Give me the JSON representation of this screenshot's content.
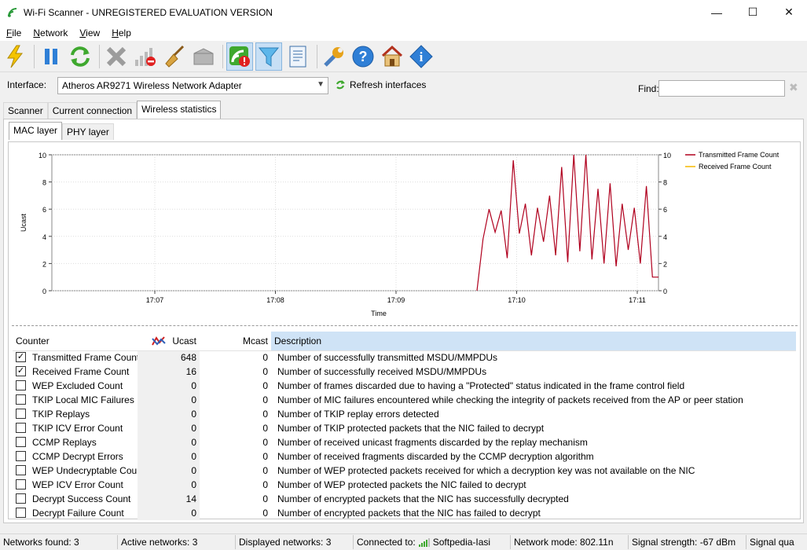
{
  "window": {
    "title": "Wi-Fi Scanner - UNREGISTERED EVALUATION VERSION",
    "minimize": "—",
    "maximize": "☐",
    "close": "✕"
  },
  "menu": [
    {
      "label": "File",
      "accel": "F",
      "rest": "ile"
    },
    {
      "label": "Network",
      "accel": "N",
      "rest": "etwork"
    },
    {
      "label": "View",
      "accel": "V",
      "rest": "iew"
    },
    {
      "label": "Help",
      "accel": "H",
      "rest": "elp"
    }
  ],
  "toolbar_icons": [
    "lightning-icon",
    "pause-icon",
    "refresh-icon",
    "delete-icon",
    "signal-remove-icon",
    "broom-icon",
    "box-icon",
    "wifi-warning-icon",
    "filter-icon",
    "notes-icon",
    "wrench-icon",
    "help-icon",
    "home-icon",
    "info-icon"
  ],
  "interface": {
    "label": "Interface:",
    "value": "Atheros AR9271 Wireless Network Adapter",
    "refresh_label": "Refresh interfaces",
    "find_label": "Find:",
    "find_value": ""
  },
  "tabs": {
    "scanner": "Scanner",
    "current": "Current connection",
    "wireless": "Wireless statistics",
    "mac": "MAC layer",
    "phy": "PHY layer"
  },
  "chart_data": {
    "type": "line",
    "xlabel": "Time",
    "ylabel": "Ucast",
    "ylim": [
      0,
      10
    ],
    "yticks": [
      "0",
      "2",
      "4",
      "6",
      "8",
      "10"
    ],
    "xticks": [
      "17:07",
      "17:08",
      "17:09",
      "17:10",
      "17:11"
    ],
    "grid": true,
    "legend_position": "top-right",
    "series": [
      {
        "name": "Transmitted Frame Count",
        "color": "#b0001e",
        "values": [
          0,
          3.8,
          6.0,
          4.3,
          5.9,
          2.4,
          9.6,
          4.2,
          6.4,
          2.6,
          6.1,
          3.6,
          7.0,
          2.6,
          9.1,
          2.1,
          10.0,
          2.9,
          10.0,
          2.3,
          7.5,
          2.0,
          7.9,
          1.8,
          6.4,
          3.0,
          6.1,
          2.0,
          7.7,
          1.0,
          1.0
        ]
      },
      {
        "name": "Received Frame Count",
        "color": "#f5b800",
        "values": []
      }
    ]
  },
  "table": {
    "headers": {
      "counter": "Counter",
      "ucast": "Ucast",
      "mcast": "Mcast",
      "desc": "Description"
    },
    "rows": [
      {
        "checked": true,
        "name": "Transmitted Frame Count",
        "ucast": "648",
        "mcast": "0",
        "desc": "Number of successfully transmitted MSDU/MMPDUs"
      },
      {
        "checked": true,
        "name": "Received Frame Count",
        "ucast": "16",
        "mcast": "0",
        "desc": "Number of successfully received MSDU/MMPDUs"
      },
      {
        "checked": false,
        "name": "WEP Excluded Count",
        "ucast": "0",
        "mcast": "0",
        "desc": "Number of frames discarded due to having a \"Protected\" status indicated in the frame control field"
      },
      {
        "checked": false,
        "name": "TKIP Local MIC Failures",
        "ucast": "0",
        "mcast": "0",
        "desc": "Number of MIC failures encountered while checking the integrity of packets received from the AP or peer station"
      },
      {
        "checked": false,
        "name": "TKIP Replays",
        "ucast": "0",
        "mcast": "0",
        "desc": "Number of TKIP replay errors detected"
      },
      {
        "checked": false,
        "name": "TKIP ICV Error Count",
        "ucast": "0",
        "mcast": "0",
        "desc": "Number of TKIP protected packets that the NIC failed to decrypt"
      },
      {
        "checked": false,
        "name": "CCMP Replays",
        "ucast": "0",
        "mcast": "0",
        "desc": "Number of received unicast fragments discarded by the replay mechanism"
      },
      {
        "checked": false,
        "name": "CCMP Decrypt Errors",
        "ucast": "0",
        "mcast": "0",
        "desc": "Number of received fragments discarded by the CCMP decryption algorithm"
      },
      {
        "checked": false,
        "name": "WEP Undecryptable Count",
        "ucast": "0",
        "mcast": "0",
        "desc": "Number of WEP protected packets received for which a decryption key was not available on the NIC"
      },
      {
        "checked": false,
        "name": "WEP ICV Error Count",
        "ucast": "0",
        "mcast": "0",
        "desc": "Number of WEP protected packets the NIC failed to decrypt"
      },
      {
        "checked": false,
        "name": "Decrypt Success Count",
        "ucast": "14",
        "mcast": "0",
        "desc": "Number of encrypted packets that the NIC has successfully decrypted"
      },
      {
        "checked": false,
        "name": "Decrypt Failure Count",
        "ucast": "0",
        "mcast": "0",
        "desc": "Number of encrypted packets that the NIC has failed to decrypt"
      }
    ]
  },
  "status": {
    "networks_found": "Networks found: 3",
    "active": "Active networks: 3",
    "displayed": "Displayed networks: 3",
    "connected_label": "Connected to:",
    "connected_value": "Softpedia-Iasi",
    "mode": "Network mode: 802.11n",
    "strength": "Signal strength: -67 dBm",
    "quality": "Signal qua"
  },
  "colors": {
    "accent": "#c7dff5",
    "desc_header": "#cfe3f6"
  }
}
